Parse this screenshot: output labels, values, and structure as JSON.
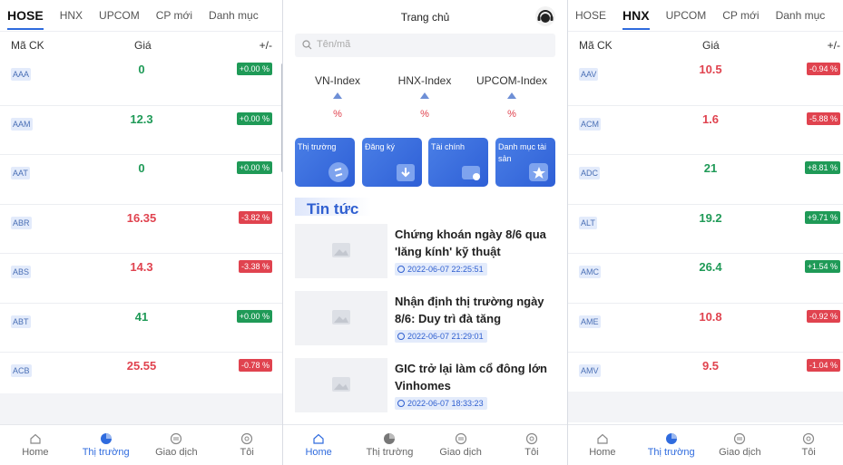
{
  "market_tabs": [
    "HOSE",
    "HNX",
    "UPCOM",
    "CP mới",
    "Danh mục"
  ],
  "table_headers": {
    "code": "Mã CK",
    "price": "Giá",
    "change": "+/-"
  },
  "hose_rows": [
    {
      "code": "AAA",
      "price": "0",
      "change": "+0.00 %",
      "dir": "up"
    },
    {
      "code": "AAM",
      "price": "12.3",
      "change": "+0.00 %",
      "dir": "up"
    },
    {
      "code": "AAT",
      "price": "0",
      "change": "+0.00 %",
      "dir": "up"
    },
    {
      "code": "ABR",
      "price": "16.35",
      "change": "-3.82 %",
      "dir": "down"
    },
    {
      "code": "ABS",
      "price": "14.3",
      "change": "-3.38 %",
      "dir": "down"
    },
    {
      "code": "ABT",
      "price": "41",
      "change": "+0.00 %",
      "dir": "up"
    },
    {
      "code": "ACB",
      "price": "25.55",
      "change": "-0.78 %",
      "dir": "down"
    }
  ],
  "hnx_rows": [
    {
      "code": "AAV",
      "price": "10.5",
      "change": "-0.94 %",
      "dir": "down"
    },
    {
      "code": "ACM",
      "price": "1.6",
      "change": "-5.88 %",
      "dir": "down"
    },
    {
      "code": "ADC",
      "price": "21",
      "change": "+8.81 %",
      "dir": "up"
    },
    {
      "code": "ALT",
      "price": "19.2",
      "change": "+9.71 %",
      "dir": "up"
    },
    {
      "code": "AMC",
      "price": "26.4",
      "change": "+1.54 %",
      "dir": "up"
    },
    {
      "code": "AME",
      "price": "10.8",
      "change": "-0.92 %",
      "dir": "down"
    },
    {
      "code": "AMV",
      "price": "9.5",
      "change": "-1.04 %",
      "dir": "down"
    }
  ],
  "bottom_nav": [
    "Home",
    "Thị trường",
    "Giao dịch",
    "Tôi"
  ],
  "home": {
    "title": "Trang chủ",
    "search_placeholder": "Tên/mã",
    "indices": [
      {
        "name": "VN-Index",
        "pct": "%"
      },
      {
        "name": "HNX-Index",
        "pct": "%"
      },
      {
        "name": "UPCOM-Index",
        "pct": "%"
      }
    ],
    "cards": [
      "Thị trường",
      "Đăng ký",
      "Tài chính",
      "Danh mục tài sản"
    ],
    "news_heading": "Tin tức",
    "news": [
      {
        "title": "Chứng khoán ngày 8/6 qua 'lăng kính' kỹ thuật",
        "date": "2022-06-07 22:25:51"
      },
      {
        "title": "Nhận định thị trường ngày 8/6: Duy trì đà tăng",
        "date": "2022-06-07 21:29:01"
      },
      {
        "title": "GIC trở lại làm cổ đông lớn Vinhomes",
        "date": "2022-06-07 18:33:23"
      }
    ]
  },
  "colors": {
    "accent": "#2f6bde",
    "up": "#1f9a57",
    "down": "#e0434f"
  }
}
